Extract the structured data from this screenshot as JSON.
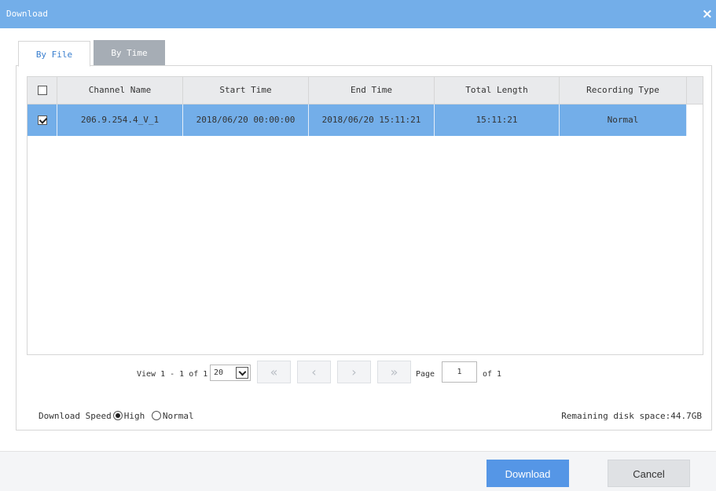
{
  "window": {
    "title": "Download",
    "close_glyph": "×"
  },
  "tabs": [
    {
      "label": "By File"
    },
    {
      "label": "By Time"
    }
  ],
  "table": {
    "headers": [
      "Channel Name",
      "Start Time",
      "End Time",
      "Total Length",
      "Recording Type"
    ],
    "rows": [
      {
        "checked": true,
        "cells": [
          "206.9.254.4_V_1",
          "2018/06/20 00:00:00",
          "2018/06/20 15:11:21",
          "15:11:21",
          "Normal"
        ]
      }
    ]
  },
  "pagination": {
    "view_text": "View 1 - 1 of 1",
    "page_size": "20",
    "page_label": "Page",
    "page_value": "1",
    "of_text": "of 1",
    "first_glyph": "«",
    "prev_glyph": "‹",
    "next_glyph": "›",
    "last_glyph": "»"
  },
  "speed": {
    "label": "Download Speed",
    "options": [
      "High",
      "Normal"
    ],
    "selected": "High"
  },
  "disk": {
    "text": "Remaining disk space:44.7GB"
  },
  "buttons": {
    "download": "Download",
    "cancel": "Cancel"
  },
  "colors": {
    "title_bar": "#73aee9",
    "selected_row": "#73aee9",
    "primary_button": "#5596e6"
  }
}
